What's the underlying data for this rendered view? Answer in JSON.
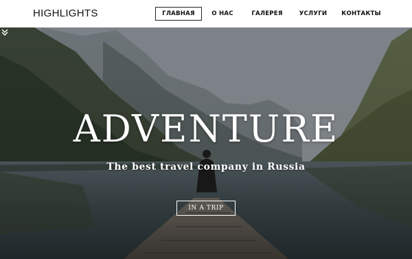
{
  "header": {
    "logo": "HIGHLIGHTS",
    "nav": [
      {
        "label": "ГЛАВНАЯ",
        "active": true
      },
      {
        "label": "О НАС",
        "active": false
      },
      {
        "label": "ГАЛЕРЕЯ",
        "active": false
      },
      {
        "label": "УСЛУГИ",
        "active": false
      },
      {
        "label": "КОНТАКТЫ",
        "active": false
      }
    ]
  },
  "hero": {
    "title": "ADVENTURE",
    "subtitle": "The best travel company in Russia",
    "cta_label": "IN A TRIP",
    "scroll_icon": "double-chevron-down-icon"
  }
}
